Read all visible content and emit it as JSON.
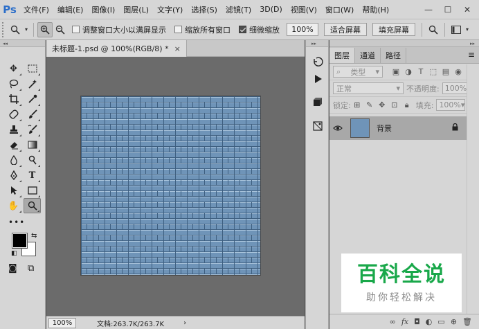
{
  "app": {
    "logo": "Ps"
  },
  "menu": [
    "文件(F)",
    "编辑(E)",
    "图像(I)",
    "图层(L)",
    "文字(Y)",
    "选择(S)",
    "滤镜(T)",
    "3D(D)",
    "视图(V)",
    "窗口(W)",
    "帮助(H)"
  ],
  "window_controls": {
    "minimize": "—",
    "maximize": "☐",
    "close": "✕"
  },
  "options": {
    "tool_icon": "zoom-icon",
    "resize_windows_label": "调整窗口大小以满屏显示",
    "resize_windows_checked": false,
    "zoom_all_label": "缩放所有窗口",
    "zoom_all_checked": false,
    "scrubby_zoom_label": "细微缩放",
    "scrubby_zoom_checked": true,
    "zoom_value": "100%",
    "fit_screen_label": "适合屏幕",
    "fill_screen_label": "填充屏幕"
  },
  "document": {
    "tab_title": "未标题-1.psd @ 100%(RGB/8) *",
    "close": "×",
    "canvas_color": "#6f94b8"
  },
  "status": {
    "zoom": "100%",
    "doc_info": "文档:263.7K/263.7K",
    "arrow": "›"
  },
  "colors": {
    "foreground": "#000000",
    "background": "#ffffff",
    "accent": "#2b6ec9"
  },
  "layers_panel": {
    "tabs": [
      "图层",
      "通道",
      "路径"
    ],
    "active_tab": "图层",
    "filter_label": "类型",
    "blend_mode": "正常",
    "opacity_label": "不透明度:",
    "opacity_value": "100%",
    "lock_label": "锁定:",
    "fill_label": "填充:",
    "fill_value": "100%",
    "layers": [
      {
        "name": "背景",
        "visible": true,
        "locked": true
      }
    ],
    "footer_icons": [
      "link-icon",
      "fx-icon",
      "mask-icon",
      "adjustment-icon",
      "folder-icon",
      "new-layer-icon",
      "trash-icon"
    ]
  },
  "watermark": {
    "title": "百科全说",
    "subtitle": "助你轻松解决"
  }
}
